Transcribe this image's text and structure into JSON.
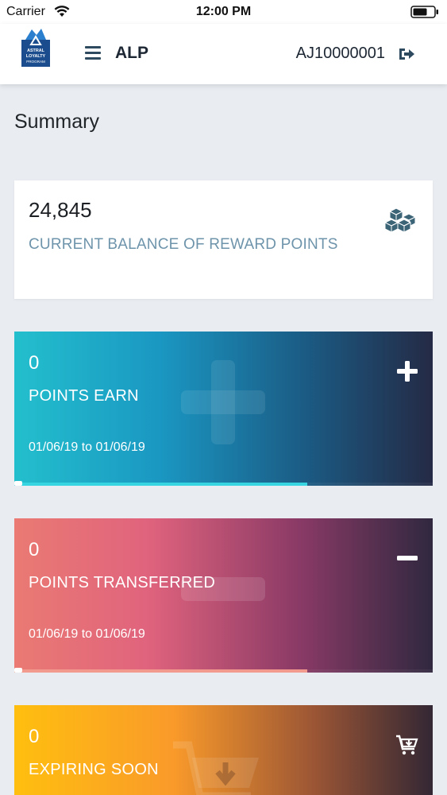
{
  "status_bar": {
    "carrier": "Carrier",
    "time": "12:00 PM"
  },
  "header": {
    "title": "ALP",
    "user_id": "AJ10000001",
    "logo_lines": [
      "ASTRAL",
      "LOYALTY",
      "PROGRAM"
    ]
  },
  "summary": {
    "title": "Summary",
    "balance": {
      "value": "24,845",
      "label": "CURRENT BALANCE OF REWARD POINTS"
    },
    "cards": [
      {
        "value": "0",
        "label": "POINTS EARN",
        "range": "01/06/19 to 01/06/19",
        "progress": 0.7,
        "icon": "plus-icon"
      },
      {
        "value": "0",
        "label": "POINTS TRANSFERRED",
        "range": "01/06/19 to 01/06/19",
        "progress": 0.7,
        "icon": "minus-icon"
      },
      {
        "value": "0",
        "label": "EXPIRING SOON",
        "icon": "cart-download-icon"
      }
    ]
  },
  "colors": {
    "accent": "#6e94ab",
    "header_icon": "#2d4a5f"
  }
}
